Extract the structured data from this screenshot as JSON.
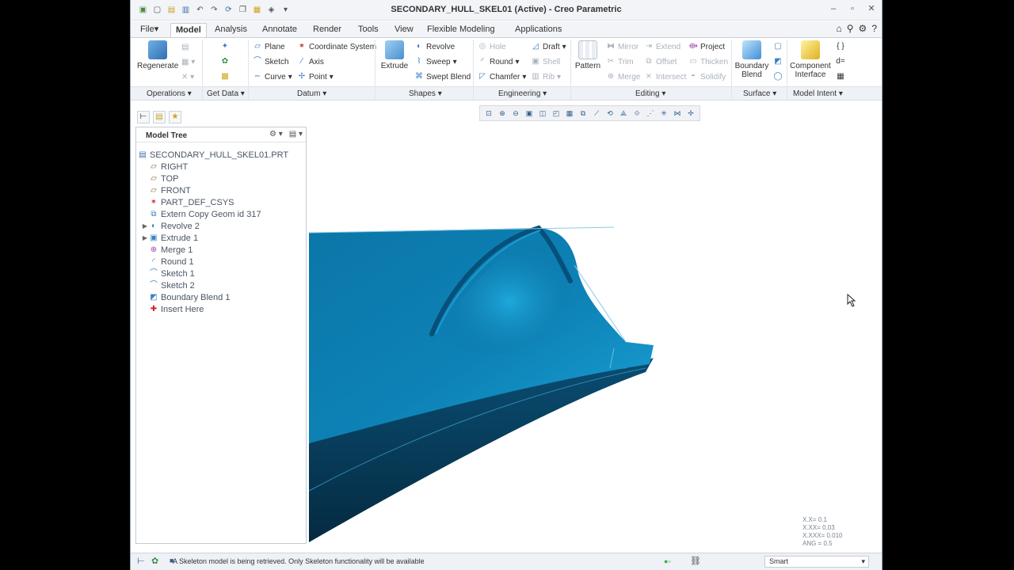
{
  "window": {
    "title": "SECONDARY_HULL_SKEL01 (Active) - Creo Parametric"
  },
  "tabs": [
    {
      "label": "File",
      "suffix": "▾"
    },
    {
      "label": "Model"
    },
    {
      "label": "Analysis"
    },
    {
      "label": "Annotate"
    },
    {
      "label": "Render"
    },
    {
      "label": "Tools"
    },
    {
      "label": "View"
    },
    {
      "label": "Flexible Modeling"
    },
    {
      "label": "Applications"
    }
  ],
  "ribbon": {
    "regenerate": "Regenerate",
    "plane": "Plane",
    "coordinate_system": "Coordinate System",
    "sketch": "Sketch",
    "axis": "Axis",
    "curve": "Curve",
    "point": "Point",
    "extrude": "Extrude",
    "revolve": "Revolve",
    "sweep": "Sweep",
    "swept_blend": "Swept Blend",
    "hole": "Hole",
    "round": "Round",
    "chamfer": "Chamfer",
    "draft": "Draft",
    "shell": "Shell",
    "rib": "Rib",
    "pattern": "Pattern",
    "mirror": "Mirror",
    "trim": "Trim",
    "merge": "Merge",
    "extend": "Extend",
    "offset": "Offset",
    "intersect": "Intersect",
    "project": "Project",
    "thicken": "Thicken",
    "solidify": "Solidify",
    "boundary_blend_1": "Boundary",
    "boundary_blend_2": "Blend",
    "component_interface_1": "Component",
    "component_interface_2": "Interface"
  },
  "groups": [
    "Operations",
    "Get Data",
    "Datum",
    "Shapes",
    "Engineering",
    "Editing",
    "Surface",
    "Model Intent"
  ],
  "model_tree": {
    "title": "Model Tree",
    "items": [
      {
        "label": "SECONDARY_HULL_SKEL01.PRT",
        "icon": "part-icon"
      },
      {
        "label": "RIGHT",
        "icon": "datum-plane-icon"
      },
      {
        "label": "TOP",
        "icon": "datum-plane-icon"
      },
      {
        "label": "FRONT",
        "icon": "datum-plane-icon"
      },
      {
        "label": "PART_DEF_CSYS",
        "icon": "csys-icon"
      },
      {
        "label": "Extern Copy Geom id 317",
        "icon": "copy-geom-icon"
      },
      {
        "label": "Revolve 2",
        "icon": "revolve-icon",
        "expandable": true
      },
      {
        "label": "Extrude 1",
        "icon": "extrude-icon",
        "expandable": true
      },
      {
        "label": "Merge 1",
        "icon": "merge-icon"
      },
      {
        "label": "Round 1",
        "icon": "round-icon"
      },
      {
        "label": "Sketch 1",
        "icon": "sketch-icon"
      },
      {
        "label": "Sketch 2",
        "icon": "sketch-icon"
      },
      {
        "label": "Boundary Blend 1",
        "icon": "boundary-blend-icon"
      },
      {
        "label": "Insert Here",
        "icon": "insert-here-icon"
      }
    ]
  },
  "coords": [
    "X.X= 0.1",
    "X.XX= 0.03",
    "X.XXX= 0.010",
    "ANG = 0.5"
  ],
  "status": {
    "message": "A Skeleton model is being retrieved. Only Skeleton functionality will be available",
    "filter": "Smart"
  },
  "colors": {
    "model_fill": "#0b6fa0",
    "model_dark": "#063a55",
    "accent": "#3a7fc4"
  }
}
